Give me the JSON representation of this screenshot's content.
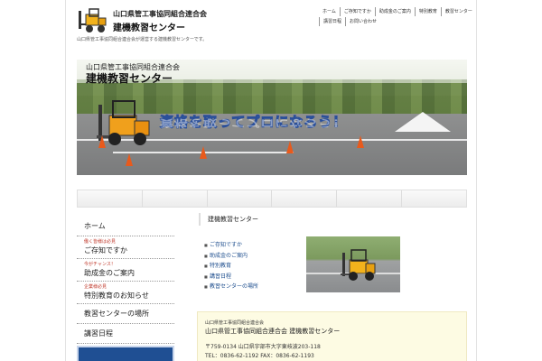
{
  "header": {
    "org_name": "山口県管工事協同組合連合会",
    "center_name": "建機教習センター",
    "logo_icon": "forklift-logo-icon"
  },
  "topnav": [
    "ホーム",
    "ご存知ですか",
    "助成金のご案内",
    "特別教育",
    "教習センター",
    "講習日程",
    "お問い合わせ"
  ],
  "tagline": "山口県管工事協同組合連合会が運営する建機教習センターです。",
  "hero": {
    "sub": "山口県管工事協同組合連合会",
    "title": "建機教習センター",
    "slogan": "資格を取ってプロになろう！"
  },
  "sidenav": [
    {
      "small": "",
      "label": "ホーム"
    },
    {
      "small": "働く皆様は必見",
      "label": "ご存知ですか"
    },
    {
      "small": "今がチャンス！",
      "label": "助成金のご案内"
    },
    {
      "small": "企業様必見",
      "label": "特別教育のお知らせ"
    },
    {
      "small": "",
      "label": "教習センターの場所"
    },
    {
      "small": "",
      "label": "講習日程"
    }
  ],
  "content": {
    "heading": "建機教習センター",
    "links": [
      "ご存知ですか",
      "助成金のご案内",
      "特別教育",
      "講習日程",
      "教習センターの場所"
    ]
  },
  "address": {
    "label": "山口県管工事協同組合連合会",
    "name": "山口県管工事協同組合連合会 建機教習センター",
    "postal": "〒759-0134 山口県宇部市大字東岐波203-118",
    "tel": "TEL：0836-62-1192 FAX：0836-62-1193"
  },
  "colors": {
    "accent": "#1f4f93",
    "alert": "#c0392b",
    "address_bg": "#fdfbe3",
    "slogan_stroke": "#2a4f9a"
  }
}
